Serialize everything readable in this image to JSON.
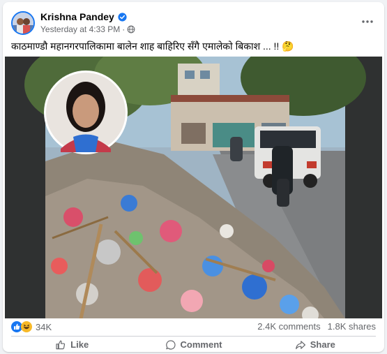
{
  "post": {
    "author": "Krishna Pandey",
    "timestamp": "Yesterday at 4:33 PM",
    "separator": "·",
    "caption": "काठमाण्डौ महानगरपालिकामा बालेन शाह बाहिरिए सँगै एमालेको बिकाश ... !!",
    "caption_emoji": "🤔"
  },
  "reactions": {
    "count": "34K",
    "icons": [
      "like-icon",
      "haha-icon"
    ]
  },
  "stats": {
    "comments": "2.4K comments",
    "shares": "1.8K shares"
  },
  "actions": {
    "like": "Like",
    "comment": "Comment",
    "share": "Share"
  },
  "colors": {
    "accent": "#1877f2",
    "text": "#050505",
    "secondary": "#65676b",
    "background": "#f0f2f5"
  }
}
